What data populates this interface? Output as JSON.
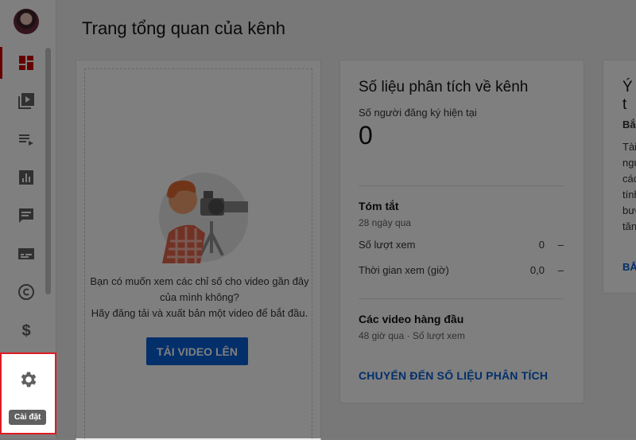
{
  "page": {
    "title": "Trang tổng quan của kênh"
  },
  "sidebar": {
    "items": [
      {
        "icon": "dashboard-icon"
      },
      {
        "icon": "videos-icon"
      },
      {
        "icon": "playlists-icon"
      },
      {
        "icon": "analytics-icon"
      },
      {
        "icon": "comments-icon"
      },
      {
        "icon": "subtitles-icon"
      },
      {
        "icon": "copyright-icon"
      },
      {
        "icon": "monetization-icon"
      }
    ],
    "settings": {
      "icon": "gear-icon",
      "tooltip": "Cài đặt"
    }
  },
  "upload_card": {
    "line1": "Bạn có muốn xem các chỉ số cho video gần đây",
    "line2": "của mình không?",
    "line3": "Hãy đăng tải và xuất bản một video để bắt đầu.",
    "button": "TẢI VIDEO LÊN"
  },
  "analytics_card": {
    "title": "Số liệu phân tích về kênh",
    "subscribers_label": "Số người đăng ký hiện tại",
    "subscribers_value": "0",
    "summary_title": "Tóm tắt",
    "summary_period": "28 ngày qua",
    "rows": [
      {
        "label": "Số lượt xem",
        "value": "0",
        "trend": "–"
      },
      {
        "label": "Thời gian xem (giờ)",
        "value": "0,0",
        "trend": "–"
      }
    ],
    "top_videos_title": "Các video hàng đầu",
    "top_videos_sub": "48 giờ qua · Số lượt xem",
    "link": "CHUYỂN ĐẾN SỐ LIỆU PHÂN TÍCH"
  },
  "ideas_card": {
    "title": "Ý t",
    "heading": "Bắ",
    "lines": [
      "Tài",
      "ngu",
      "các",
      "tính",
      "bưc",
      "tăn"
    ],
    "link": "BẮ"
  },
  "colors": {
    "accent": "#cc0000",
    "link": "#065fd4",
    "highlight": "#e01a22"
  }
}
